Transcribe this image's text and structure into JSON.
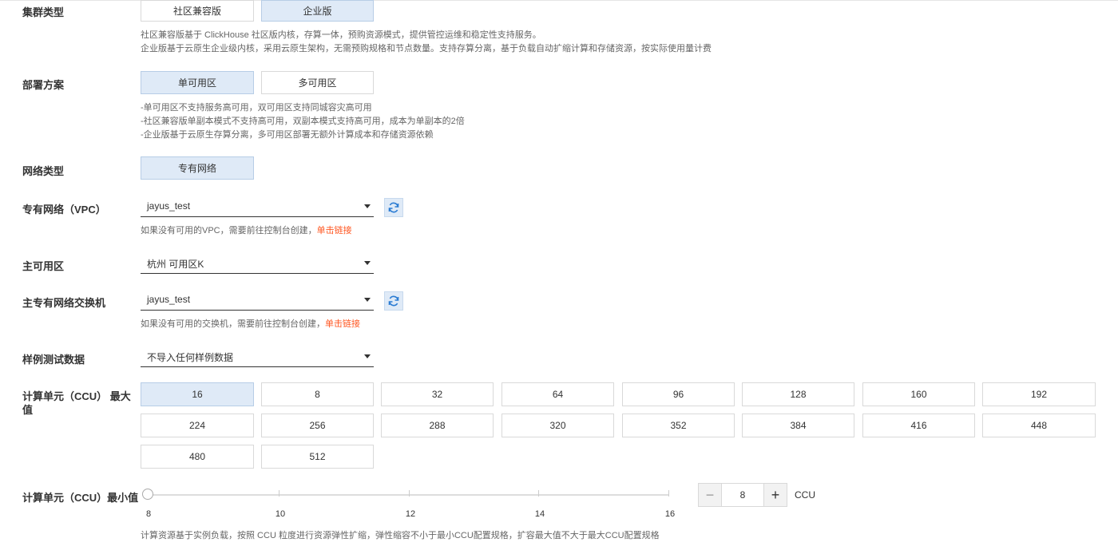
{
  "cluster_type": {
    "label": "集群类型",
    "options": [
      "社区兼容版",
      "企业版"
    ],
    "help": [
      "社区兼容版基于 ClickHouse 社区版内核，存算一体，预购资源模式，提供管控运维和稳定性支持服务。",
      "企业版基于云原生企业级内核，采用云原生架构，无需预购规格和节点数量。支持存算分离，基于负载自动扩缩计算和存储资源，按实际使用量计费"
    ]
  },
  "deployment": {
    "label": "部署方案",
    "options": [
      "单可用区",
      "多可用区"
    ],
    "help": [
      "-单可用区不支持服务高可用，双可用区支持同城容灾高可用",
      "-社区兼容版单副本模式不支持高可用，双副本模式支持高可用，成本为单副本的2倍",
      "-企业版基于云原生存算分离，多可用区部署无额外计算成本和存储资源依赖"
    ]
  },
  "network_type": {
    "label": "网络类型",
    "option": "专有网络"
  },
  "vpc": {
    "label": "专有网络（VPC）",
    "value": "jayus_test",
    "help": "如果没有可用的VPC，需要前往控制台创建，",
    "link": "单击链接"
  },
  "zone": {
    "label": "主可用区",
    "value": "杭州 可用区K"
  },
  "vswitch": {
    "label": "主专有网络交换机",
    "value": "jayus_test",
    "help": "如果没有可用的交换机，需要前往控制台创建，",
    "link": "单击链接"
  },
  "sample_data": {
    "label": "样例测试数据",
    "value": "不导入任何样例数据"
  },
  "ccu_max": {
    "label_line1": "计算单元（CCU） 最大",
    "label_line2": "值",
    "options": [
      "16",
      "8",
      "32",
      "64",
      "96",
      "128",
      "160",
      "192",
      "224",
      "256",
      "288",
      "320",
      "352",
      "384",
      "416",
      "448",
      "480",
      "512"
    ],
    "selected": "16"
  },
  "ccu_min": {
    "label": "计算单元（CCU）最小值",
    "ticks": [
      "8",
      "10",
      "12",
      "14",
      "16"
    ],
    "value": "8",
    "minus": "−",
    "plus": "+",
    "unit": "CCU",
    "help": "计算资源基于实例负载，按照 CCU 粒度进行资源弹性扩缩，弹性缩容不小于最小CCU配置规格，扩容最大值不大于最大CCU配置规格"
  },
  "colors": {
    "selected_bg": "#dfeaf7",
    "link": "#ff5722",
    "refresh_icon": "#2b7cd3"
  }
}
